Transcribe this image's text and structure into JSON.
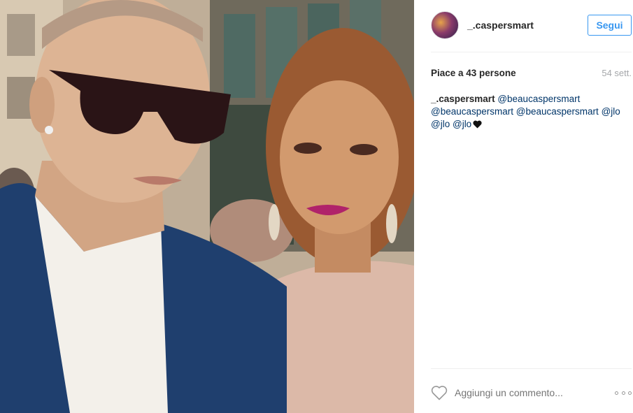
{
  "photo": {
    "alt": "Post image"
  },
  "header": {
    "username": "_.caspersmart",
    "follow_label": "Segui"
  },
  "stats": {
    "likes": "Piace a 43 persone",
    "time": "54 sett."
  },
  "caption": {
    "user": "_.caspersmart",
    "mentions": [
      "@beaucaspersmart",
      "@beaucaspersmart",
      "@beaucaspersmart",
      "@jlo",
      "@jlo",
      "@jlo"
    ],
    "emoji": "black-heart"
  },
  "comment": {
    "placeholder": "Aggiungi un commento..."
  },
  "icons": {
    "like": "heart-outline-icon",
    "more": "more-options-icon"
  },
  "colors": {
    "accent": "#3897f0",
    "mention": "#003569",
    "muted": "#a5a7aa",
    "text": "#262626"
  }
}
